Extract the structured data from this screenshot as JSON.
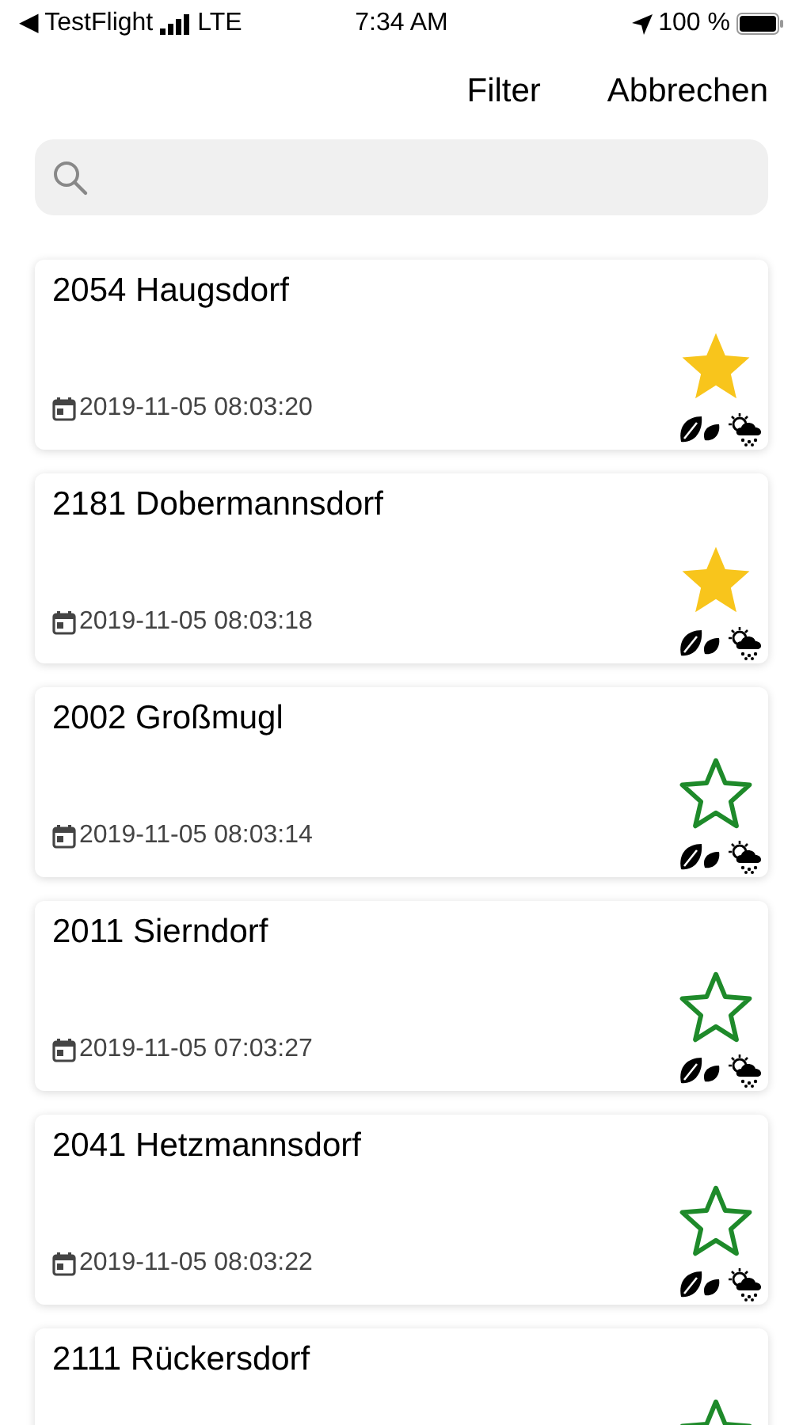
{
  "status_bar": {
    "back_label": "◀ TestFlight",
    "network": "LTE",
    "time": "7:34 AM",
    "battery": "100 %"
  },
  "nav": {
    "buttons": [
      "Filter",
      "Abbrechen"
    ]
  },
  "stations": [
    {
      "title": "2054 Haugsdorf",
      "date": "2019-11-05 08:03:20",
      "favorite": true
    },
    {
      "title": "2181 Dobermannsdorf",
      "date": "2019-11-05 08:03:18",
      "favorite": true
    },
    {
      "title": "2002 Großmugl",
      "date": "2019-11-05 08:03:14",
      "favorite": false
    },
    {
      "title": "2011 Sierndorf",
      "date": "2019-11-05 07:03:27",
      "favorite": false
    },
    {
      "title": "2041 Hetzmannsdorf",
      "date": "2019-11-05 08:03:22",
      "favorite": false
    },
    {
      "title": "2111 Rückersdorf",
      "favorite": false
    }
  ]
}
